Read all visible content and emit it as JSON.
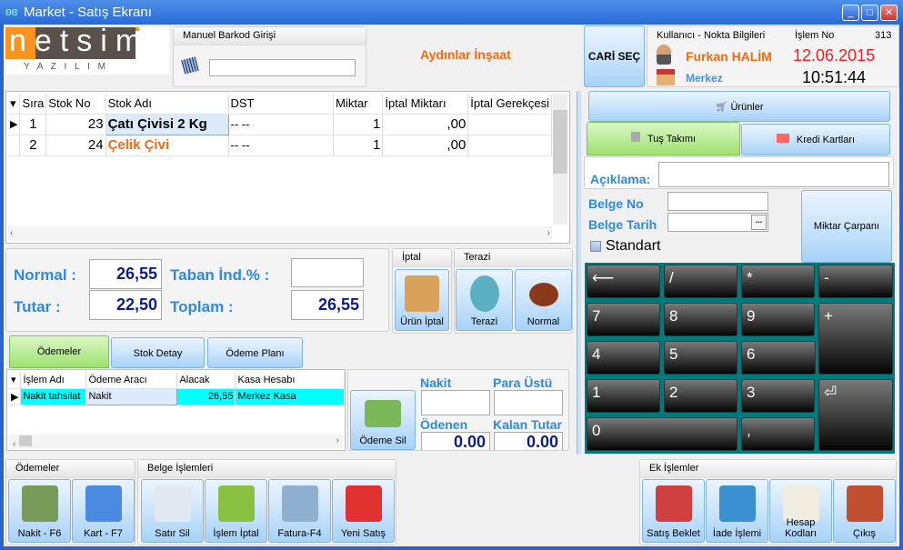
{
  "window": {
    "title": "Market - Satış Ekranı",
    "minimize": "_",
    "maximize": "□",
    "close": "✕"
  },
  "logo": {
    "brand": "netsim",
    "sub": "Y A Z I L I M"
  },
  "barcode": {
    "title": "Manuel Barkod Girişi",
    "value": ""
  },
  "company": "Aydınlar İnşaat",
  "cari_button": "CARİ SEÇ",
  "user_info": {
    "title": "Kullanıcı - Nokta Bilgileri",
    "islem_label": "İşlem No",
    "islem_no": "313",
    "user": "Furkan HALİM",
    "location": "Merkez",
    "date": "12.06.2015",
    "time": "10:51:44"
  },
  "items_grid": {
    "columns": [
      "Sıra",
      "Stok No",
      "Stok Adı",
      "DST",
      "Miktar",
      "İptal Miktarı",
      "İptal Gerekçesi"
    ],
    "rows": [
      {
        "sira": "1",
        "stok_no": "23",
        "stok_adi": "Çatı Çivisi 2 Kg",
        "dst": "-- --",
        "miktar": "1",
        "iptal_miktari": ",00",
        "iptal_gerekcesi": ""
      },
      {
        "sira": "2",
        "stok_no": "24",
        "stok_adi": "Çelik Çivi",
        "dst": "-- --",
        "miktar": "1",
        "iptal_miktari": ",00",
        "iptal_gerekcesi": ""
      }
    ]
  },
  "totals": {
    "normal_label": "Normal :",
    "normal": "26,55",
    "tutar_label": "Tutar :",
    "tutar": "22,50",
    "taban_label": "Taban İnd.% :",
    "taban": "",
    "toplam_label": "Toplam :",
    "toplam": "26,55"
  },
  "iptal": {
    "title": "İptal",
    "button": "Ürün İptal"
  },
  "terazi": {
    "title": "Terazi",
    "terazi_button": "Terazi",
    "normal_button": "Normal"
  },
  "tabs": [
    "Ödemeler",
    "Stok Detay",
    "Ödeme Planı"
  ],
  "payments": {
    "columns": [
      "İşlem Adı",
      "Ödeme Aracı",
      "Alacak",
      "Kasa Hesabı"
    ],
    "rows": [
      {
        "islem": "Nakit tahsilat",
        "arac": "Nakit",
        "alacak": "26,55",
        "kasa": "Merkez Kasa"
      }
    ]
  },
  "odeme_sil": "Ödeme Sil",
  "cash": {
    "nakit_label": "Nakit",
    "nakit": "",
    "para_ustu_label": "Para Üstü",
    "para_ustu": "",
    "odenen_label": "Ödenen",
    "odenen": "0.00",
    "kalan_label": "Kalan Tutar",
    "kalan": "0.00"
  },
  "right": {
    "urunler": "Ürünler",
    "tus_takimi": "Tuş Takımı",
    "kredi_kartlari": "Kredi Kartları",
    "aciklama_label": "Açıklama:",
    "aciklama": "",
    "belge_no_label": "Belge No",
    "belge_no": "",
    "belge_tarih_label": "Belge Tarih",
    "belge_tarih": "",
    "ellipsis": "...",
    "standart": "Standart",
    "standart_checked": false,
    "miktar_carpani": "Miktar Çarpanı"
  },
  "keypad": [
    "⟵",
    "/",
    "*",
    "-",
    "7",
    "8",
    "9",
    "+",
    "4",
    "5",
    "6",
    "1",
    "2",
    "3",
    "⏎",
    "0",
    ","
  ],
  "bottom": {
    "odemeler_title": "Ödemeler",
    "nakit": "Nakit - F6",
    "kart": "Kart - F7",
    "belge_title": "Belge İşlemleri",
    "satir_sil": "Satır Sil",
    "islem_iptal": "İşlem İptal",
    "fatura": "Fatura-F4",
    "yeni_satis": "Yeni Satış",
    "ek_title": "Ek İşlemler",
    "satis_beklet": "Satış Beklet",
    "iade": "İade İşlemi",
    "hesap_kodlari": "Hesap Kodları",
    "cikis": "Çıkış"
  },
  "colors": {
    "accent_orange": "#f26b10",
    "label_blue": "#2d8ae0",
    "value_navy": "#0b1d87",
    "date_red": "#ff1a1a",
    "keypad_bg": "#007a7a",
    "selected_cyan": "#00ffff"
  }
}
